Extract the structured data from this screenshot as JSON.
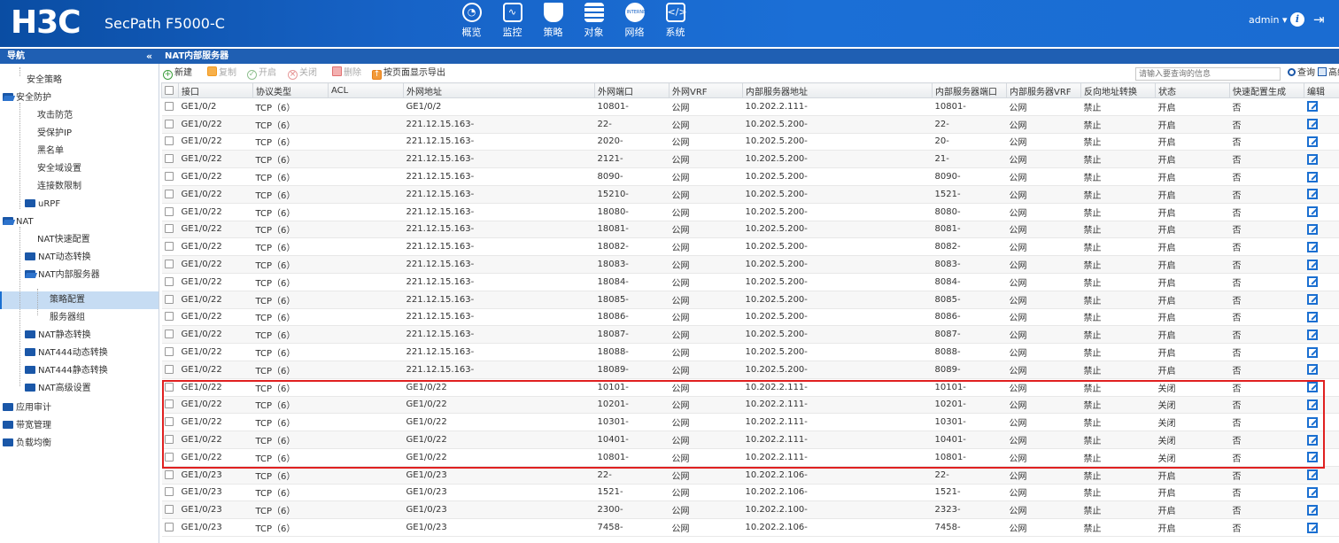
{
  "header": {
    "logo": "H3C",
    "product": "SecPath F5000-C",
    "nav": [
      {
        "label": "概览",
        "icon": "dashboard-icon"
      },
      {
        "label": "监控",
        "icon": "monitor-icon"
      },
      {
        "label": "策略",
        "icon": "shield-icon"
      },
      {
        "label": "对象",
        "icon": "objects-icon"
      },
      {
        "label": "网络",
        "icon": "internet-icon"
      },
      {
        "label": "系统",
        "icon": "system-icon"
      }
    ],
    "user": "admin ▾",
    "info_glyph": "i",
    "logout_glyph": "⇥"
  },
  "subbar": {
    "nav_title": "导航",
    "collapse_glyph": "«",
    "page_title": "NAT内部服务器"
  },
  "sidebar": {
    "items": [
      {
        "label": "安全策略",
        "level": 1,
        "folder": false
      },
      {
        "label": "安全防护",
        "level": 0,
        "folder": true,
        "open": true
      },
      {
        "label": "攻击防范",
        "level": 1,
        "folder": false
      },
      {
        "label": "受保护IP",
        "level": 1,
        "folder": false
      },
      {
        "label": "黑名单",
        "level": 1,
        "folder": false
      },
      {
        "label": "安全域设置",
        "level": 1,
        "folder": false
      },
      {
        "label": "连接数限制",
        "level": 1,
        "folder": false
      },
      {
        "label": "uRPF",
        "level": 1,
        "folder": true
      },
      {
        "label": "NAT",
        "level": 0,
        "folder": true,
        "open": true
      },
      {
        "label": "NAT快速配置",
        "level": 1,
        "folder": false
      },
      {
        "label": "NAT动态转换",
        "level": 1,
        "folder": true
      },
      {
        "label": "NAT内部服务器",
        "level": 1,
        "folder": true,
        "open": true
      },
      {
        "label": "策略配置",
        "level": 2,
        "folder": false,
        "selected": true
      },
      {
        "label": "服务器组",
        "level": 2,
        "folder": false
      },
      {
        "label": "NAT静态转换",
        "level": 1,
        "folder": true
      },
      {
        "label": "NAT444动态转换",
        "level": 1,
        "folder": true
      },
      {
        "label": "NAT444静态转换",
        "level": 1,
        "folder": true
      },
      {
        "label": "NAT高级设置",
        "level": 1,
        "folder": true
      },
      {
        "label": "应用审计",
        "level": 0,
        "folder": true
      },
      {
        "label": "带宽管理",
        "level": 0,
        "folder": true
      },
      {
        "label": "负载均衡",
        "level": 0,
        "folder": true
      }
    ]
  },
  "toolbar": {
    "new": "新建",
    "copy": "复制",
    "enable": "开启",
    "disable": "关闭",
    "delete": "删除",
    "export": "按页面显示导出",
    "search_placeholder": "请输入要查询的信息",
    "query": "查询",
    "advanced": "高级查询"
  },
  "table": {
    "columns": [
      "接口",
      "协议类型",
      "ACL",
      "外网地址",
      "外网端口",
      "外网VRF",
      "内部服务器地址",
      "内部服务器端口",
      "内部服务器VRF",
      "反向地址转换",
      "状态",
      "快速配置生成",
      "编辑"
    ],
    "rows": [
      [
        "GE1/0/2",
        "TCP（6）",
        "",
        "GE1/0/2",
        "10801-",
        "公网",
        "10.202.2.111-",
        "10801-",
        "公网",
        "禁止",
        "开启",
        "否"
      ],
      [
        "GE1/0/22",
        "TCP（6）",
        "",
        "221.12.15.163-",
        "22-",
        "公网",
        "10.202.5.200-",
        "22-",
        "公网",
        "禁止",
        "开启",
        "否"
      ],
      [
        "GE1/0/22",
        "TCP（6）",
        "",
        "221.12.15.163-",
        "2020-",
        "公网",
        "10.202.5.200-",
        "20-",
        "公网",
        "禁止",
        "开启",
        "否"
      ],
      [
        "GE1/0/22",
        "TCP（6）",
        "",
        "221.12.15.163-",
        "2121-",
        "公网",
        "10.202.5.200-",
        "21-",
        "公网",
        "禁止",
        "开启",
        "否"
      ],
      [
        "GE1/0/22",
        "TCP（6）",
        "",
        "221.12.15.163-",
        "8090-",
        "公网",
        "10.202.5.200-",
        "8090-",
        "公网",
        "禁止",
        "开启",
        "否"
      ],
      [
        "GE1/0/22",
        "TCP（6）",
        "",
        "221.12.15.163-",
        "15210-",
        "公网",
        "10.202.5.200-",
        "1521-",
        "公网",
        "禁止",
        "开启",
        "否"
      ],
      [
        "GE1/0/22",
        "TCP（6）",
        "",
        "221.12.15.163-",
        "18080-",
        "公网",
        "10.202.5.200-",
        "8080-",
        "公网",
        "禁止",
        "开启",
        "否"
      ],
      [
        "GE1/0/22",
        "TCP（6）",
        "",
        "221.12.15.163-",
        "18081-",
        "公网",
        "10.202.5.200-",
        "8081-",
        "公网",
        "禁止",
        "开启",
        "否"
      ],
      [
        "GE1/0/22",
        "TCP（6）",
        "",
        "221.12.15.163-",
        "18082-",
        "公网",
        "10.202.5.200-",
        "8082-",
        "公网",
        "禁止",
        "开启",
        "否"
      ],
      [
        "GE1/0/22",
        "TCP（6）",
        "",
        "221.12.15.163-",
        "18083-",
        "公网",
        "10.202.5.200-",
        "8083-",
        "公网",
        "禁止",
        "开启",
        "否"
      ],
      [
        "GE1/0/22",
        "TCP（6）",
        "",
        "221.12.15.163-",
        "18084-",
        "公网",
        "10.202.5.200-",
        "8084-",
        "公网",
        "禁止",
        "开启",
        "否"
      ],
      [
        "GE1/0/22",
        "TCP（6）",
        "",
        "221.12.15.163-",
        "18085-",
        "公网",
        "10.202.5.200-",
        "8085-",
        "公网",
        "禁止",
        "开启",
        "否"
      ],
      [
        "GE1/0/22",
        "TCP（6）",
        "",
        "221.12.15.163-",
        "18086-",
        "公网",
        "10.202.5.200-",
        "8086-",
        "公网",
        "禁止",
        "开启",
        "否"
      ],
      [
        "GE1/0/22",
        "TCP（6）",
        "",
        "221.12.15.163-",
        "18087-",
        "公网",
        "10.202.5.200-",
        "8087-",
        "公网",
        "禁止",
        "开启",
        "否"
      ],
      [
        "GE1/0/22",
        "TCP（6）",
        "",
        "221.12.15.163-",
        "18088-",
        "公网",
        "10.202.5.200-",
        "8088-",
        "公网",
        "禁止",
        "开启",
        "否"
      ],
      [
        "GE1/0/22",
        "TCP（6）",
        "",
        "221.12.15.163-",
        "18089-",
        "公网",
        "10.202.5.200-",
        "8089-",
        "公网",
        "禁止",
        "开启",
        "否"
      ],
      [
        "GE1/0/22",
        "TCP（6）",
        "",
        "GE1/0/22",
        "10101-",
        "公网",
        "10.202.2.111-",
        "10101-",
        "公网",
        "禁止",
        "关闭",
        "否"
      ],
      [
        "GE1/0/22",
        "TCP（6）",
        "",
        "GE1/0/22",
        "10201-",
        "公网",
        "10.202.2.111-",
        "10201-",
        "公网",
        "禁止",
        "关闭",
        "否"
      ],
      [
        "GE1/0/22",
        "TCP（6）",
        "",
        "GE1/0/22",
        "10301-",
        "公网",
        "10.202.2.111-",
        "10301-",
        "公网",
        "禁止",
        "关闭",
        "否"
      ],
      [
        "GE1/0/22",
        "TCP（6）",
        "",
        "GE1/0/22",
        "10401-",
        "公网",
        "10.202.2.111-",
        "10401-",
        "公网",
        "禁止",
        "关闭",
        "否"
      ],
      [
        "GE1/0/22",
        "TCP（6）",
        "",
        "GE1/0/22",
        "10801-",
        "公网",
        "10.202.2.111-",
        "10801-",
        "公网",
        "禁止",
        "关闭",
        "否"
      ],
      [
        "GE1/0/23",
        "TCP（6）",
        "",
        "GE1/0/23",
        "22-",
        "公网",
        "10.202.2.106-",
        "22-",
        "公网",
        "禁止",
        "开启",
        "否"
      ],
      [
        "GE1/0/23",
        "TCP（6）",
        "",
        "GE1/0/23",
        "1521-",
        "公网",
        "10.202.2.106-",
        "1521-",
        "公网",
        "禁止",
        "开启",
        "否"
      ],
      [
        "GE1/0/23",
        "TCP（6）",
        "",
        "GE1/0/23",
        "2300-",
        "公网",
        "10.202.2.100-",
        "2323-",
        "公网",
        "禁止",
        "开启",
        "否"
      ],
      [
        "GE1/0/23",
        "TCP（6）",
        "",
        "GE1/0/23",
        "7458-",
        "公网",
        "10.202.2.106-",
        "7458-",
        "公网",
        "禁止",
        "开启",
        "否"
      ]
    ]
  },
  "colors": {
    "header_blue": "#1763c7",
    "status_on": "#20b020",
    "status_off": "#e02020",
    "highlight_box": "#e02020"
  }
}
